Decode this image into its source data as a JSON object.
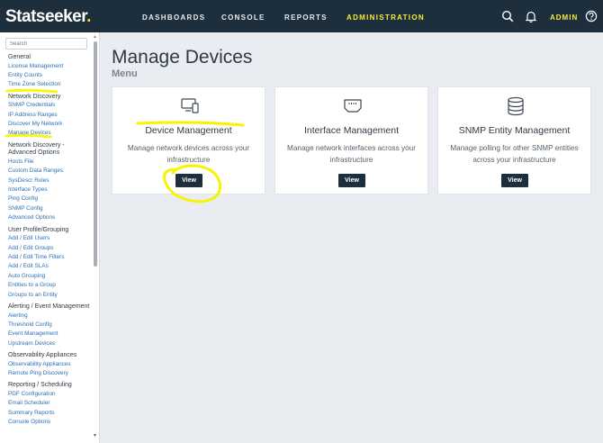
{
  "app": {
    "logo_text": "Statseeker",
    "logo_dot": "."
  },
  "nav": {
    "links": [
      "DASHBOARDS",
      "CONSOLE",
      "REPORTS",
      "ADMINISTRATION"
    ],
    "active": "ADMINISTRATION",
    "user_label": "ADMIN"
  },
  "sidebar": {
    "search_placeholder": "Search",
    "groups": [
      {
        "title": "General",
        "items": [
          "License Management",
          "Entity Counts",
          "Time Zone Selection"
        ]
      },
      {
        "title": "Network Discovery",
        "items": [
          "SNMP Credentials",
          "IP Address Ranges",
          "Discover My Network",
          "Manage Devices"
        ]
      },
      {
        "title": "Network Discovery - Advanced Options",
        "items": [
          "Hosts File",
          "Custom Data Ranges",
          "SysDescr Rules",
          "Interface Types",
          "Ping Config",
          "SNMP Config",
          "Advanced Options"
        ]
      },
      {
        "title": "User Profile/Grouping",
        "items": [
          "Add / Edit Users",
          "Add / Edit Groups",
          "Add / Edit Time Filters",
          "Add / Edit SLAs",
          "Auto Grouping",
          "Entities to a Group",
          "Groups to an Entity"
        ]
      },
      {
        "title": "Alerting / Event Management",
        "items": [
          "Alerting",
          "Threshold Config",
          "Event Management",
          "Upstream Devices"
        ]
      },
      {
        "title": "Observability Appliances",
        "items": [
          "Observability Appliances",
          "Remote Ping Discovery"
        ]
      },
      {
        "title": "Reporting / Scheduling",
        "items": [
          "PDF Configuration",
          "Email Scheduler",
          "Summary Reports",
          "Console Options"
        ]
      }
    ]
  },
  "main": {
    "title": "Manage Devices",
    "subtitle": "Menu",
    "cards": [
      {
        "title": "Device Management",
        "desc": "Manage network devices across your infrastructure",
        "button": "View",
        "icon": "devices-icon"
      },
      {
        "title": "Interface Management",
        "desc": "Manage network interfaces across your infrastructure",
        "button": "View",
        "icon": "network-port-icon"
      },
      {
        "title": "SNMP Entity Management",
        "desc": "Manage polling for other SNMP entities across your infrastructure",
        "button": "View",
        "icon": "database-icon"
      }
    ]
  },
  "colors": {
    "nav_bg": "#1d2f3d",
    "accent_yellow": "#f6ec3a",
    "link_blue": "#2b6fb4",
    "highlight": "#f7f400"
  }
}
